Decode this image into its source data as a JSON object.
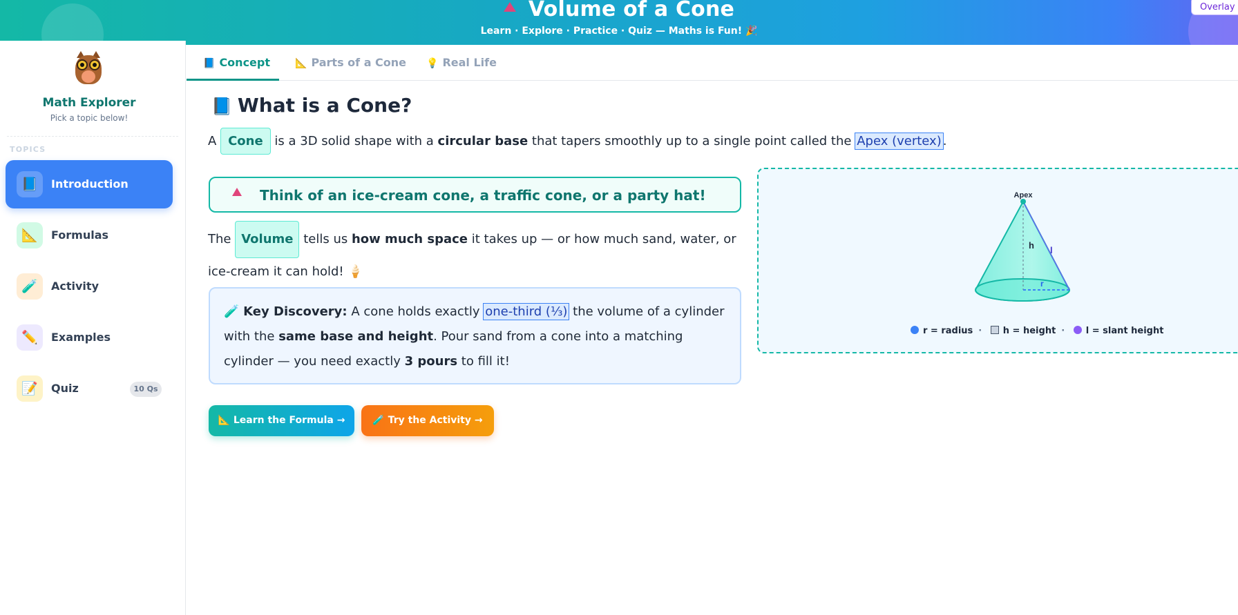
{
  "header": {
    "title": "Volume of a Cone",
    "subtitle": "Learn · Explore · Practice · Quiz — Maths is Fun! 🎉",
    "overlay_label": "Overlay"
  },
  "sidebar": {
    "brand": "Math Explorer",
    "brand_sub": "Pick a topic below!",
    "section_label": "TOPICS",
    "items": [
      {
        "label": "Introduction",
        "icon": "📘",
        "active": true
      },
      {
        "label": "Formulas",
        "icon": "📐"
      },
      {
        "label": "Activity",
        "icon": "🧪"
      },
      {
        "label": "Examples",
        "icon": "✏️"
      },
      {
        "label": "Quiz",
        "icon": "📝",
        "badge": "10 Qs"
      }
    ]
  },
  "tabs": [
    {
      "label": "Concept",
      "icon": "📘",
      "active": true
    },
    {
      "label": "Parts of a Cone",
      "icon": "📐"
    },
    {
      "label": "Real Life",
      "icon": "💡"
    }
  ],
  "main": {
    "heading": "What is a Cone?",
    "heading_icon": "📘",
    "para1": {
      "prefix": "A",
      "term": "Cone",
      "mid": "is a 3D solid shape with a",
      "bold": "circular base",
      "rest": "that tapers smoothly up to a single point called the",
      "highlight": "Apex (vertex)",
      "end": "."
    },
    "callout": "Think of an ice-cream cone, a traffic cone, or a party hat!",
    "para2": {
      "prefix": "The",
      "term": "Volume",
      "mid": "tells us",
      "bold": "how much space",
      "rest": "it takes up — or how much sand, water, or ice-cream it can hold! 🍦"
    },
    "key": {
      "icon": "🧪",
      "label": "Key Discovery:",
      "t1": "A cone holds exactly",
      "highlight": "one-third (⅓)",
      "t2": "the volume of a cylinder with the",
      "bold1": "same base and height",
      "t3": ". Pour sand from a cone into a matching cylinder — you need exactly",
      "bold2": "3 pours",
      "t4": "to fill it!"
    },
    "buttons": {
      "formula": "📐 Learn the Formula →",
      "activity": "🧪 Try the Activity →"
    }
  },
  "diagram": {
    "apex_label": "Apex",
    "h_label": "h",
    "l_label": "l",
    "r_label": "r",
    "legend": [
      {
        "text": "r = radius",
        "color": "#3b82f6"
      },
      {
        "text": "h = height",
        "color": "#cbd5e1"
      },
      {
        "text": "l = slant height",
        "color": "#8b5cf6"
      }
    ]
  }
}
